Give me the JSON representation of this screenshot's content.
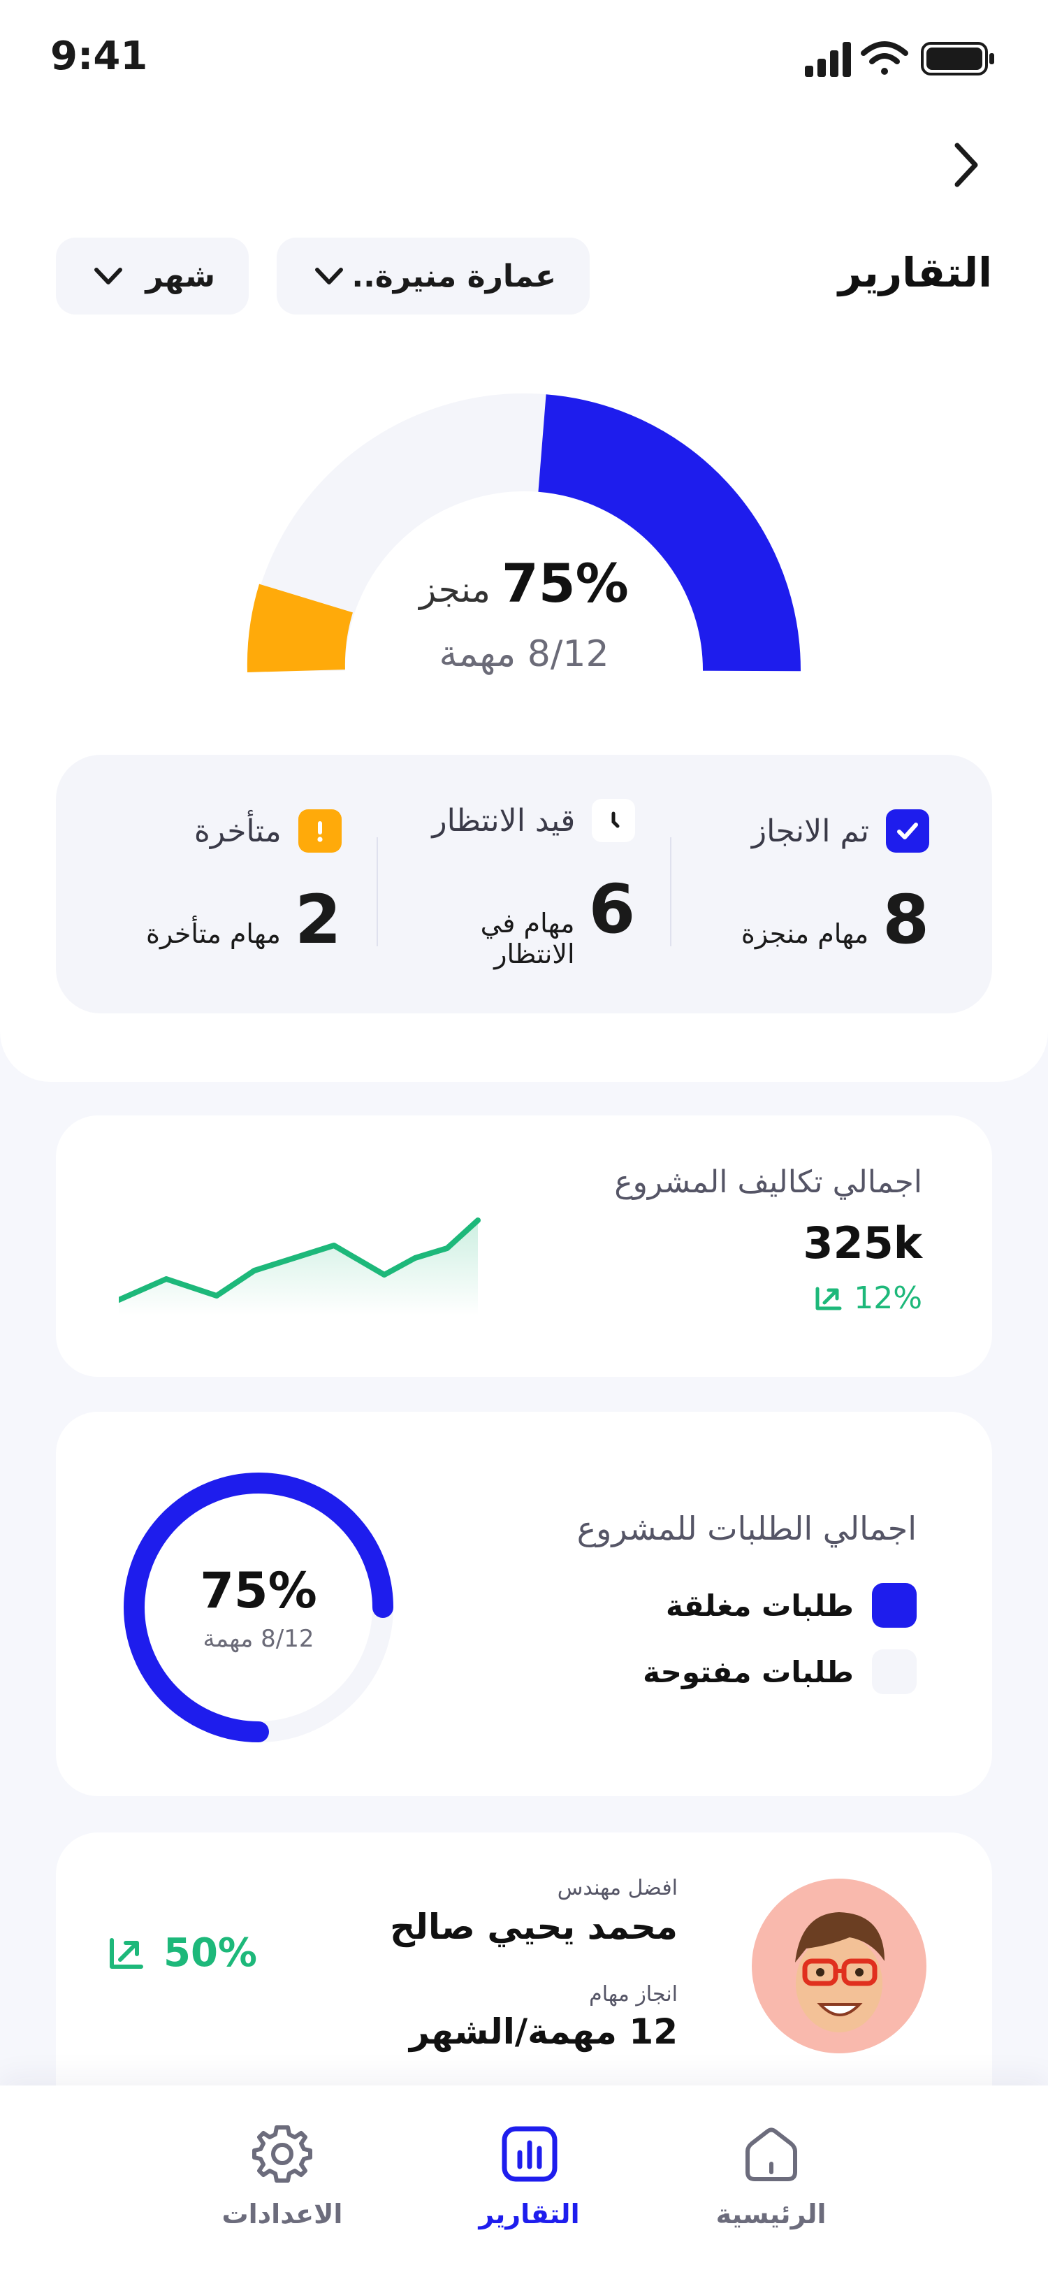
{
  "status_bar": {
    "time": "9:41"
  },
  "header": {
    "title": "التقارير",
    "filter_building": "عمارة منيرة..",
    "filter_period": "شهر"
  },
  "progress": {
    "percent_label": "75%",
    "done_label": "منجز",
    "tasks_label": "8/12 مهمة",
    "completed_fraction": 0.75
  },
  "stats": [
    {
      "title": "تم الانجاز",
      "value": "8",
      "caption": "مهام منجزة",
      "color": "#1e1ded"
    },
    {
      "title": "قيد الانتظار",
      "value": "6",
      "caption": "مهام في الانتظار",
      "color": "#ffffff"
    },
    {
      "title": "متأخرة",
      "value": "2",
      "caption": "مهام متأخرة",
      "color": "#ffaa0a"
    }
  ],
  "cost_card": {
    "title": "اجمالي تكاليف المشروع",
    "value": "325k",
    "change": "12%"
  },
  "requests_card": {
    "title": "اجمالي الطلبات للمشروع",
    "legend_closed": "طلبات مغلقة",
    "legend_open": "طلبات مفتوحة",
    "percent_label": "75%",
    "tasks_label": "8/12 مهمة",
    "closed_fraction": 0.75
  },
  "engineer_card": {
    "best_label": "افضل مهندس",
    "name": "محمد يحيي صالح",
    "tasks_label": "انجاز مهام",
    "tasks_value": "12 مهمة/الشهر",
    "change": "50%"
  },
  "nav": {
    "home": "الرئيسية",
    "reports": "التقارير",
    "settings": "الاعدادات"
  },
  "colors": {
    "primary": "#1e1ded",
    "warning": "#ffaa0a",
    "success": "#1db87a",
    "track": "#f4f5fa"
  }
}
